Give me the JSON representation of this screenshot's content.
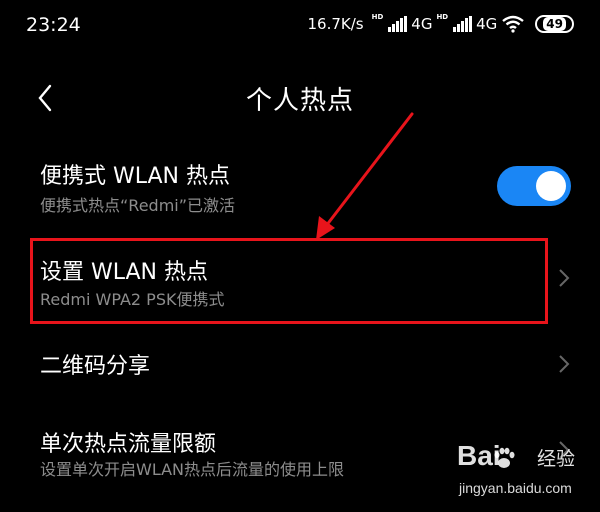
{
  "status_bar": {
    "time": "23:24",
    "net_speed": "16.7K/s",
    "hd_label": "HD",
    "network_type": "4G",
    "network_type_2": "4G",
    "battery": "49"
  },
  "header": {
    "title": "个人热点",
    "back_icon": "chevron-left-icon"
  },
  "rows": {
    "portable_hotspot": {
      "title": "便携式 WLAN 热点",
      "subtitle": "便携式热点“Redmi”已激活",
      "toggle_on": true,
      "toggle_color": "#1a86f5"
    },
    "hotspot_settings": {
      "title": "设置 WLAN 热点",
      "subtitle": "Redmi WPA2 PSK便携式"
    },
    "qr_share": {
      "title": "二维码分享"
    },
    "data_limit": {
      "title": "单次热点流量限额",
      "subtitle": "设置单次开启WLAN热点后流量的使用上限"
    }
  },
  "annotation": {
    "highlight_color": "#e8141b"
  },
  "watermark": {
    "brand": "Bai  ",
    "product": "经验",
    "url": "jingyan.baidu.com"
  }
}
